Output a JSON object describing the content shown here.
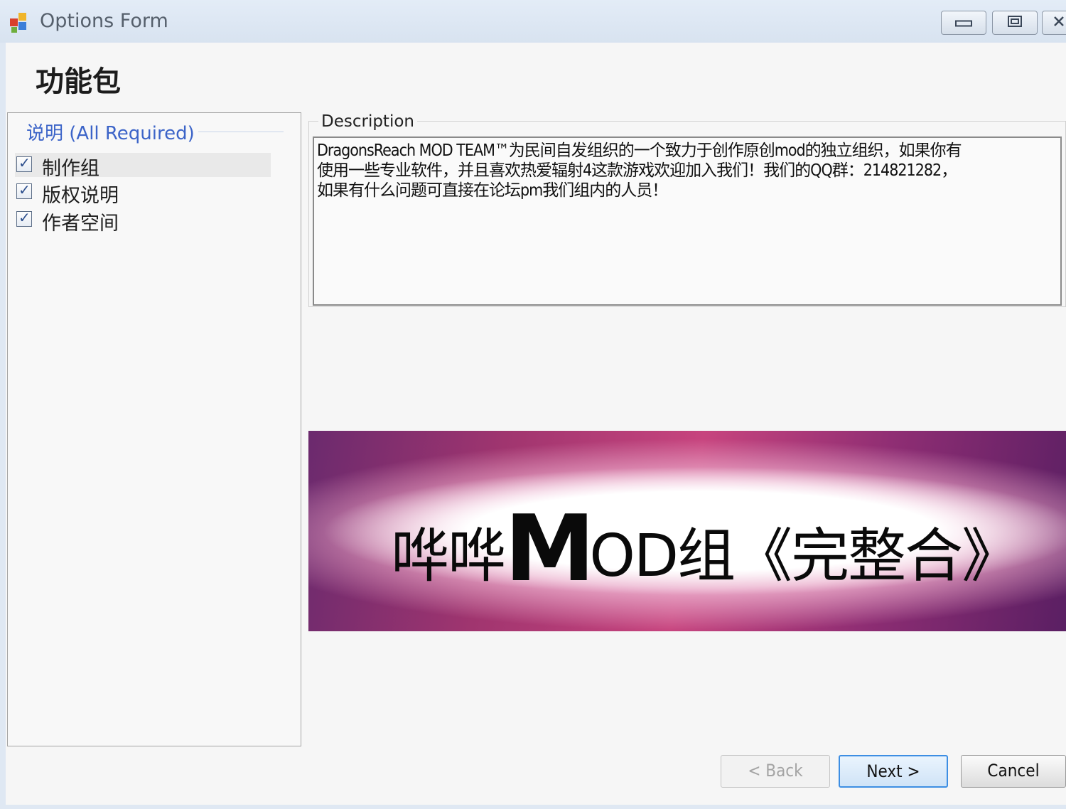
{
  "window": {
    "title": "Options Form",
    "controls": [
      "minimize-icon",
      "maximize-icon",
      "close-icon"
    ]
  },
  "page": {
    "heading": "功能包"
  },
  "options_group": {
    "header": "说明 (All Required)",
    "items": [
      {
        "label": "制作组",
        "checked": true
      },
      {
        "label": "版权说明",
        "checked": true
      },
      {
        "label": "作者空间",
        "checked": true
      }
    ]
  },
  "description": {
    "legend": "Description",
    "lines": [
      "DragonsReach MOD TEAM™为民间自发组织的一个致力于创作原创mod的独立组织，如果你有",
      "使用一些专业软件，并且喜欢热爱辐射4这款游戏欢迎加入我们！我们的QQ群：214821282，",
      "如果有什么问题可直接在论坛pm我们组内的人员！"
    ]
  },
  "banner": {
    "text_prefix": "哗哗",
    "text_big": "M",
    "text_suffix": "OD组《完整合》"
  },
  "buttons": {
    "back": "< Back",
    "next": "Next >",
    "cancel": "Cancel"
  },
  "colors": {
    "accent": "#3c64c8",
    "default_button_border": "#3d8ee3"
  }
}
